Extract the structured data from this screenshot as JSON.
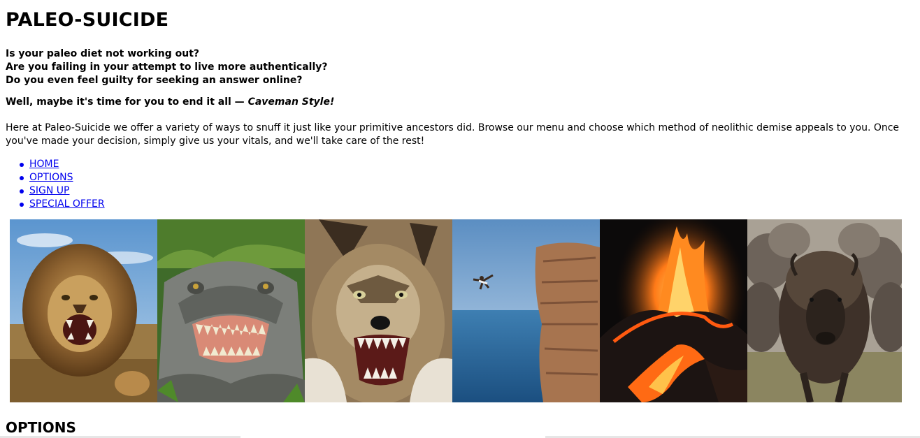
{
  "header": {
    "title": "PALEO-SUICIDE"
  },
  "questions": [
    "Is your paleo diet not working out?",
    "Are you failing in your attempt to live more authentically?",
    "Do you even feel guilty for seeking an answer online?"
  ],
  "tagline": {
    "lead": "Well, maybe it's time for you to end it all — ",
    "emphasis": "Caveman Style!"
  },
  "intro": "Here at Paleo-Suicide we offer a variety of ways to snuff it just like your primitive ancestors did. Browse our menu and choose which method of neolithic demise appeals to you. Once you've made your decision, simply give us your vitals, and we'll take care of the rest!",
  "nav": {
    "items": [
      {
        "label": "HOME"
      },
      {
        "label": "OPTIONS"
      },
      {
        "label": "SIGN UP"
      },
      {
        "label": "SPECIAL OFFER"
      }
    ]
  },
  "gallery": {
    "images": [
      {
        "subject": "roaring lion"
      },
      {
        "subject": "alligator with open jaws"
      },
      {
        "subject": "snarling wolf"
      },
      {
        "subject": "person leaping off sea cliff"
      },
      {
        "subject": "erupting volcano with lava"
      },
      {
        "subject": "charging bison herd"
      }
    ]
  },
  "section": {
    "heading": "OPTIONS"
  },
  "colors": {
    "link": "#0000ee",
    "text": "#000000",
    "background": "#ffffff"
  }
}
